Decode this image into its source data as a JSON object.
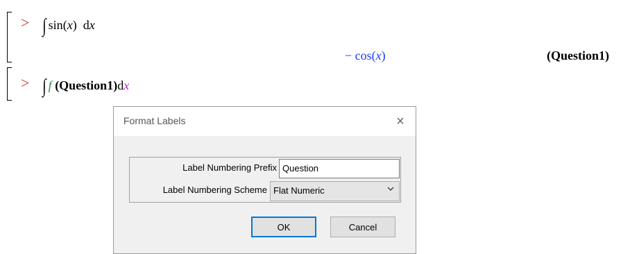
{
  "worksheet": {
    "prompt_symbol": ">",
    "line1": {
      "func": "sin",
      "var": "x",
      "differential": "d",
      "dvar": "x"
    },
    "output": {
      "minus": "−",
      "func": "cos",
      "var": "x",
      "label": "(Question1)"
    },
    "line2": {
      "func": "f",
      "label_ref": "(Question1)",
      "differential": "d",
      "dvar": "x"
    }
  },
  "dialog": {
    "title": "Format Labels",
    "close_icon": "×",
    "prefix_label": "Label Numbering Prefix",
    "prefix_value": "Question",
    "scheme_label": "Label Numbering Scheme",
    "scheme_value": "Flat Numeric",
    "ok_label": "OK",
    "cancel_label": "Cancel"
  },
  "colors": {
    "prompt": "#c0392b",
    "output_math": "#1a3cff",
    "function_name": "#2e8b57",
    "dx_var": "#b22cc8",
    "focus_border": "#0078d7"
  }
}
